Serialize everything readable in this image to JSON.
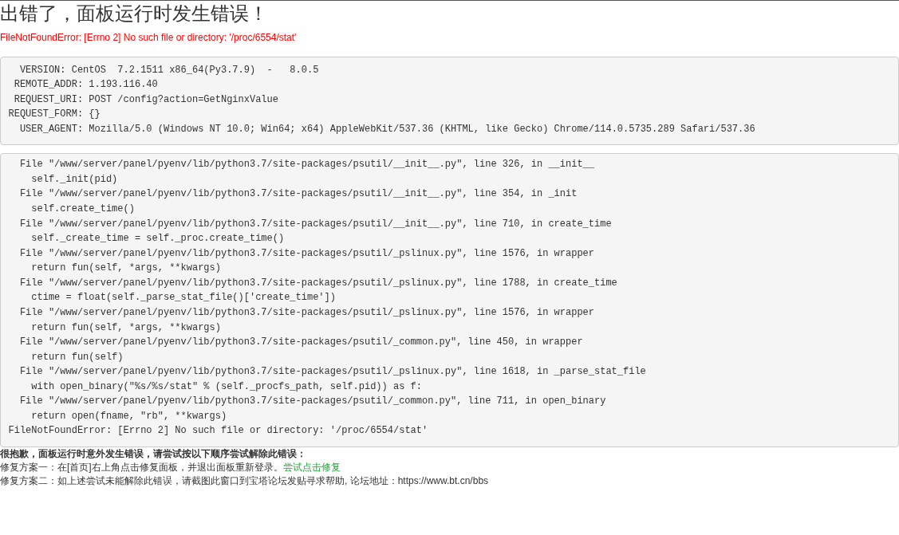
{
  "title": "出错了，面板运行时发生错误！",
  "error_message": "FileNotFoundError: [Errno 2] No such file or directory: '/proc/6554/stat'",
  "request_info": {
    "lines": [
      "  VERSION: CentOS  7.2.1511 x86_64(Py3.7.9)  -   8.0.5",
      " REMOTE_ADDR: 1.193.116.40",
      " REQUEST_URI: POST /config?action=GetNginxValue",
      "REQUEST_FORM: {}",
      "  USER_AGENT: Mozilla/5.0 (Windows NT 10.0; Win64; x64) AppleWebKit/537.36 (KHTML, like Gecko) Chrome/114.0.5735.289 Safari/537.36"
    ]
  },
  "traceback": {
    "lines": [
      {
        "kind": "frame",
        "text": "File \"/www/server/panel/pyenv/lib/python3.7/site-packages/psutil/__init__.py\", line 326, in __init__"
      },
      {
        "kind": "code",
        "text": "self._init(pid)"
      },
      {
        "kind": "frame",
        "text": "File \"/www/server/panel/pyenv/lib/python3.7/site-packages/psutil/__init__.py\", line 354, in _init"
      },
      {
        "kind": "code",
        "text": "self.create_time()"
      },
      {
        "kind": "frame",
        "text": "File \"/www/server/panel/pyenv/lib/python3.7/site-packages/psutil/__init__.py\", line 710, in create_time"
      },
      {
        "kind": "code",
        "text": "self._create_time = self._proc.create_time()"
      },
      {
        "kind": "frame",
        "text": "File \"/www/server/panel/pyenv/lib/python3.7/site-packages/psutil/_pslinux.py\", line 1576, in wrapper"
      },
      {
        "kind": "code",
        "text": "return fun(self, *args, **kwargs)"
      },
      {
        "kind": "frame",
        "text": "File \"/www/server/panel/pyenv/lib/python3.7/site-packages/psutil/_pslinux.py\", line 1788, in create_time"
      },
      {
        "kind": "code",
        "text": "ctime = float(self._parse_stat_file()['create_time'])"
      },
      {
        "kind": "frame",
        "text": "File \"/www/server/panel/pyenv/lib/python3.7/site-packages/psutil/_pslinux.py\", line 1576, in wrapper"
      },
      {
        "kind": "code",
        "text": "return fun(self, *args, **kwargs)"
      },
      {
        "kind": "frame",
        "text": "File \"/www/server/panel/pyenv/lib/python3.7/site-packages/psutil/_common.py\", line 450, in wrapper"
      },
      {
        "kind": "code",
        "text": "return fun(self)"
      },
      {
        "kind": "frame",
        "text": "File \"/www/server/panel/pyenv/lib/python3.7/site-packages/psutil/_pslinux.py\", line 1618, in _parse_stat_file"
      },
      {
        "kind": "code",
        "text": "with open_binary(\"%s/%s/stat\" % (self._procfs_path, self.pid)) as f:"
      },
      {
        "kind": "frame",
        "text": "File \"/www/server/panel/pyenv/lib/python3.7/site-packages/psutil/_common.py\", line 711, in open_binary"
      },
      {
        "kind": "code",
        "text": "return open(fname, \"rb\", **kwargs)"
      },
      {
        "kind": "error",
        "text": "FileNotFoundError: [Errno 2] No such file or directory: '/proc/6554/stat'"
      }
    ]
  },
  "help": {
    "heading": "很抱歉，面板运行时意外发生错误，请尝试按以下顺序尝试解除此错误：",
    "steps": [
      {
        "text": "修复方案一：在[首页]右上角点击修复面板，并退出面板重新登录。",
        "link": "尝试点击修复"
      },
      {
        "text": "修复方案二：如上述尝试未能解除此错误，请截图此窗口到宝塔论坛发贴寻求帮助, 论坛地址：https://www.bt.cn/bbs"
      }
    ]
  }
}
